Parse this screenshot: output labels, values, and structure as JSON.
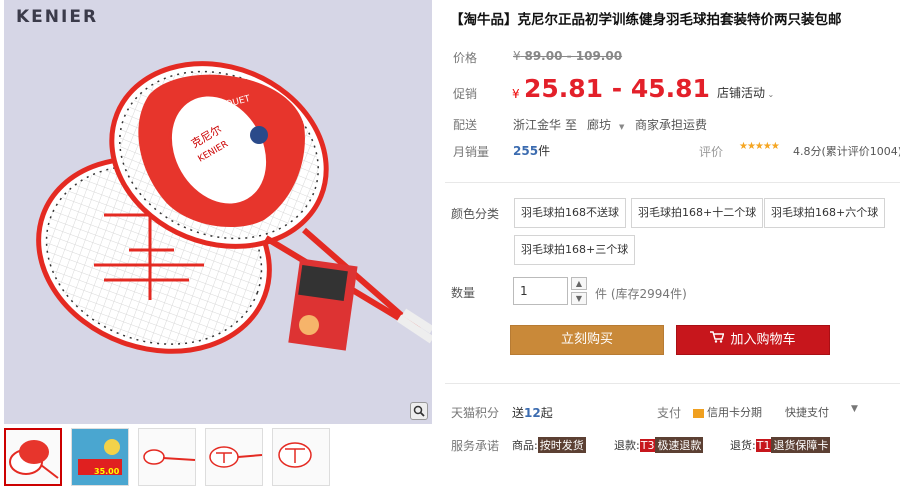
{
  "gallery": {
    "brand": "KENIER",
    "package_text": "克尼尔",
    "package_brand": "KENIER",
    "package_label": "RACQUET",
    "thumb_promo": "35.00"
  },
  "product": {
    "title": "【淘牛品】克尼尔正品初学训练健身羽毛球拍套装特价两只装包邮"
  },
  "price": {
    "label": "价格",
    "currency": "¥",
    "original": "89.00 - 109.00",
    "promo_label": "促销",
    "promo": "25.81 - 45.81",
    "shop_promo": "店铺活动"
  },
  "shipping": {
    "label": "配送",
    "from": "浙江金华",
    "to_word": "至",
    "to": "廊坊",
    "fee": "商家承担运费"
  },
  "sales": {
    "label": "月销量",
    "count": "255",
    "unit": "件",
    "rating_label": "评价",
    "stars": "★★★★★",
    "rating": "4.8分(累计评价1004)"
  },
  "sku": {
    "label": "颜色分类",
    "options": [
      "羽毛球拍168不送球",
      "羽毛球拍168+十二个球",
      "羽毛球拍168+六个球",
      "羽毛球拍168+三个球"
    ]
  },
  "quantity": {
    "label": "数量",
    "value": "1",
    "unit": "件",
    "stock": "(库存2994件)"
  },
  "actions": {
    "buy": "立刻购买",
    "cart": "加入购物车"
  },
  "points": {
    "label": "天猫积分",
    "prefix": "送",
    "value": "12",
    "suffix": "起"
  },
  "payment": {
    "label": "支付",
    "credit": "信用卡分期",
    "quick": "快捷支付"
  },
  "service": {
    "label": "服务承诺",
    "goods_label": "商品:",
    "goods_badge": "按时发货",
    "refund_label": "退款:",
    "refund_code": "T3",
    "refund_badge": "极速退款",
    "return_label": "退货:",
    "return_code": "T1",
    "return_badge": "退货保障卡"
  },
  "colors": {
    "promo_red": "#e3202a",
    "buy_orange": "#c98939",
    "cart_red": "#c7161c",
    "link_blue": "#3c6cb0"
  }
}
